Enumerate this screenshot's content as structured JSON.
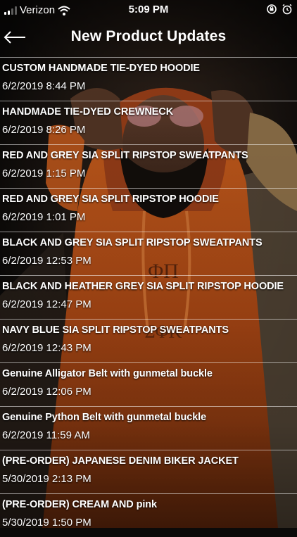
{
  "status_bar": {
    "carrier": "Verizon",
    "time": "5:09 PM",
    "signal_bars_filled": 2,
    "icons": [
      "wifi-icon",
      "orientation-lock-icon",
      "alarm-icon"
    ]
  },
  "header": {
    "title": "New Product Updates",
    "back_icon": "arrow-left-icon"
  },
  "colors": {
    "hoodie_orange": "#c9591b",
    "text": "#ffffff",
    "divider": "#bdbdbd"
  },
  "items": [
    {
      "name": "CUSTOM HANDMADE TIE-DYED HOODIE",
      "date": "6/2/2019 8:44 PM"
    },
    {
      "name": "HANDMADE TIE-DYED CREWNECK",
      "date": "6/2/2019 8:26 PM"
    },
    {
      "name": "RED AND GREY SIA SPLIT RIPSTOP SWEATPANTS",
      "date": "6/2/2019 1:15 PM"
    },
    {
      "name": "RED AND GREY SIA SPLIT RIPSTOP HOODIE",
      "date": "6/2/2019 1:01 PM"
    },
    {
      "name": "BLACK AND GREY SIA SPLIT RIPSTOP SWEATPANTS",
      "date": "6/2/2019 12:53 PM"
    },
    {
      "name": "BLACK AND HEATHER GREY SIA SPLIT RIPSTOP HOODIE",
      "date": "6/2/2019 12:47 PM"
    },
    {
      "name": "NAVY BLUE SIA SPLIT RIPSTOP SWEATPANTS",
      "date": "6/2/2019 12:43 PM"
    },
    {
      "name": "Genuine Alligator Belt with gunmetal buckle",
      "date": "6/2/2019 12:06 PM"
    },
    {
      "name": "Genuine Python Belt with gunmetal buckle",
      "date": "6/2/2019 11:59 AM"
    },
    {
      "name": "(PRE-ORDER) JAPANESE DENIM BIKER JACKET",
      "date": "5/30/2019 2:13 PM"
    },
    {
      "name": "(PRE-ORDER) CREAM AND pink",
      "date": "5/30/2019 1:50 PM"
    }
  ]
}
